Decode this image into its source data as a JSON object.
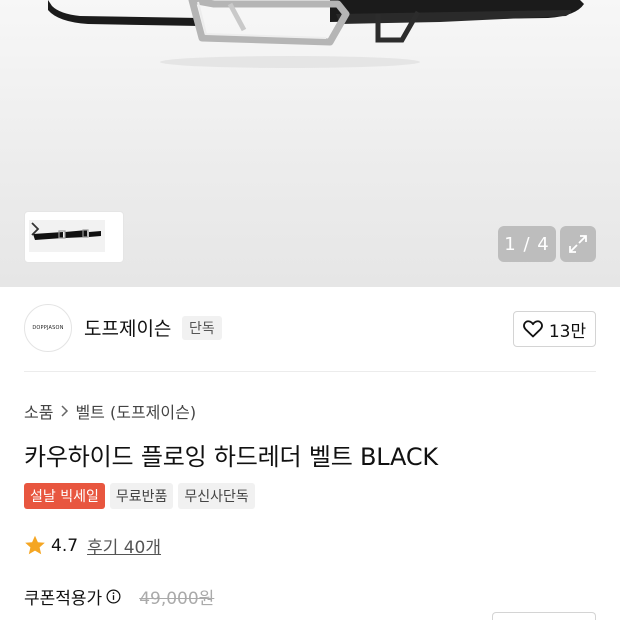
{
  "gallery": {
    "pager": "1 / 4",
    "icons": {
      "expand": "expand-icon",
      "chevron": "chevron-right-icon"
    }
  },
  "brand": {
    "logo_text": "DOPPJASON",
    "name": "도프제이슨",
    "tag": "단독",
    "likes": "13만",
    "icons": {
      "heart": "heart-outline-icon"
    }
  },
  "breadcrumb": {
    "category": "소품",
    "subcategory": "벨트 (도프제이슨)"
  },
  "product": {
    "title": "카우하이드 플로잉 하드레더 벨트 BLACK",
    "badges": [
      "설날 빅세일",
      "무료반품",
      "무신사단독"
    ],
    "rating": "4.7",
    "reviews": "후기 40개",
    "price_label": "쿠폰적용가",
    "original_price": "49,000원"
  },
  "colors": {
    "accent_badge": "#e8563f",
    "star": "#f5a623",
    "pager_bg": "#bdbdbd"
  }
}
